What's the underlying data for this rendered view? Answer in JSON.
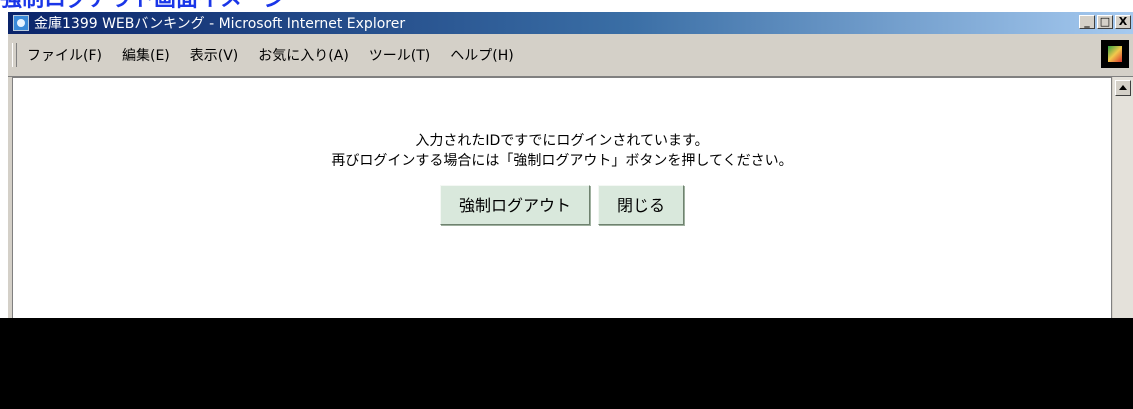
{
  "heading": "強制ログアウト画面イメージ",
  "window": {
    "title": "金庫1399 WEBバンキング - Microsoft Internet Explorer",
    "controls": [
      "_",
      "□",
      "X"
    ]
  },
  "menu": {
    "items": [
      "ファイル(F)",
      "編集(E)",
      "表示(V)",
      "お気に入り(A)",
      "ツール(T)",
      "ヘルプ(H)"
    ]
  },
  "content": {
    "message_line1": "入力されたIDですでにログインされています。",
    "message_line2": "再びログインする場合には「強制ログアウト」ボタンを押してください。",
    "force_logout_label": "強制ログアウト",
    "close_label": "閉じる"
  },
  "icons": {
    "app": "ie-icon",
    "throbber": "windows-logo-icon",
    "scroll": "scroll-up-arrow-icon"
  },
  "colors": {
    "heading": "#1a36e8",
    "titlebar": "#0a246a",
    "button_face": "#d9e8dc"
  }
}
